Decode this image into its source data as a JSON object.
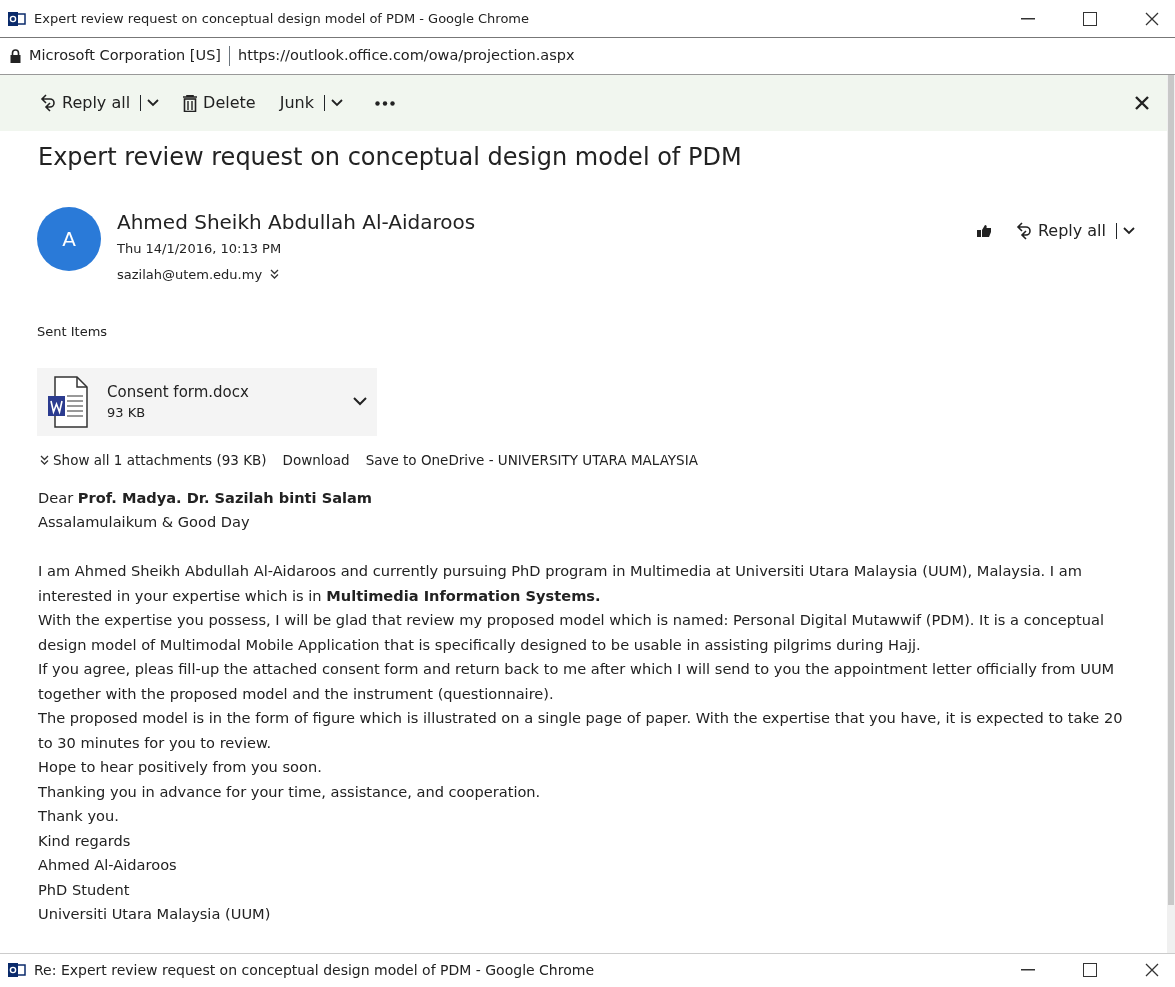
{
  "window": {
    "title": "Expert review request on conceptual design model of PDM - Google Chrome"
  },
  "address_bar": {
    "site": "Microsoft Corporation [US]",
    "url": "https://outlook.office.com/owa/projection.aspx"
  },
  "toolbar": {
    "actions": [
      {
        "kind": "reply",
        "label": "Reply all"
      },
      {
        "kind": "delete",
        "label": "Delete"
      },
      {
        "kind": "junk",
        "label": "Junk"
      },
      {
        "kind": "more"
      }
    ]
  },
  "message": {
    "subject": "Expert review request on conceptual design model of PDM",
    "sender": {
      "initial": "A",
      "name": "Ahmed Sheikh Abdullah Al-Aidaroos",
      "date": "Thu 14/1/2016, 10:13 PM",
      "to": "sazilah@utem.edu.my"
    },
    "reply_label": "Reply all",
    "folder": "Sent Items",
    "attachment": {
      "name": "Consent form.docx",
      "size": "93 KB"
    },
    "attachment_links": [
      "Show all 1 attachments (93 KB)",
      "Download",
      "Save to OneDrive - UNIVERSITY UTARA MALAYSIA"
    ],
    "body": [
      [
        "Dear **Prof. Madya. Dr. Sazilah binti Salam**",
        "Assalamulaikum & Good Day"
      ],
      [
        "I am Ahmed Sheikh Abdullah Al-Aidaroos and currently pursuing PhD program in Multimedia at Universiti Utara Malaysia (UUM), Malaysia. I am interested in your expertise which is in **Multimedia Information Systems.**",
        "With the expertise you possess, I will be glad that review my proposed model which is named: Personal Digital Mutawwif (PDM). It is a conceptual design model of Multimodal Mobile Application that is specifically designed to be usable in assisting pilgrims during Hajj.",
        "If you agree, pleas fill-up the attached consent form and return back to me after which I will send to you the appointment letter officially from UUM together with the proposed model and the instrument (questionnaire).",
        "The proposed model is in the form of figure which is illustrated on a single page of paper. With the expertise that you have, it is expected to take 20 to 30 minutes for you to review.",
        "Hope to hear positively from you soon.",
        "Thanking you in advance for your time, assistance, and cooperation.",
        "Thank you.",
        "Kind regards",
        "Ahmed Al-Aidaroos",
        "PhD Student",
        "Universiti Utara Malaysia (UUM)"
      ]
    ]
  },
  "second_window": {
    "title": "Re: Expert review request on conceptual design model of PDM - Google Chrome"
  }
}
